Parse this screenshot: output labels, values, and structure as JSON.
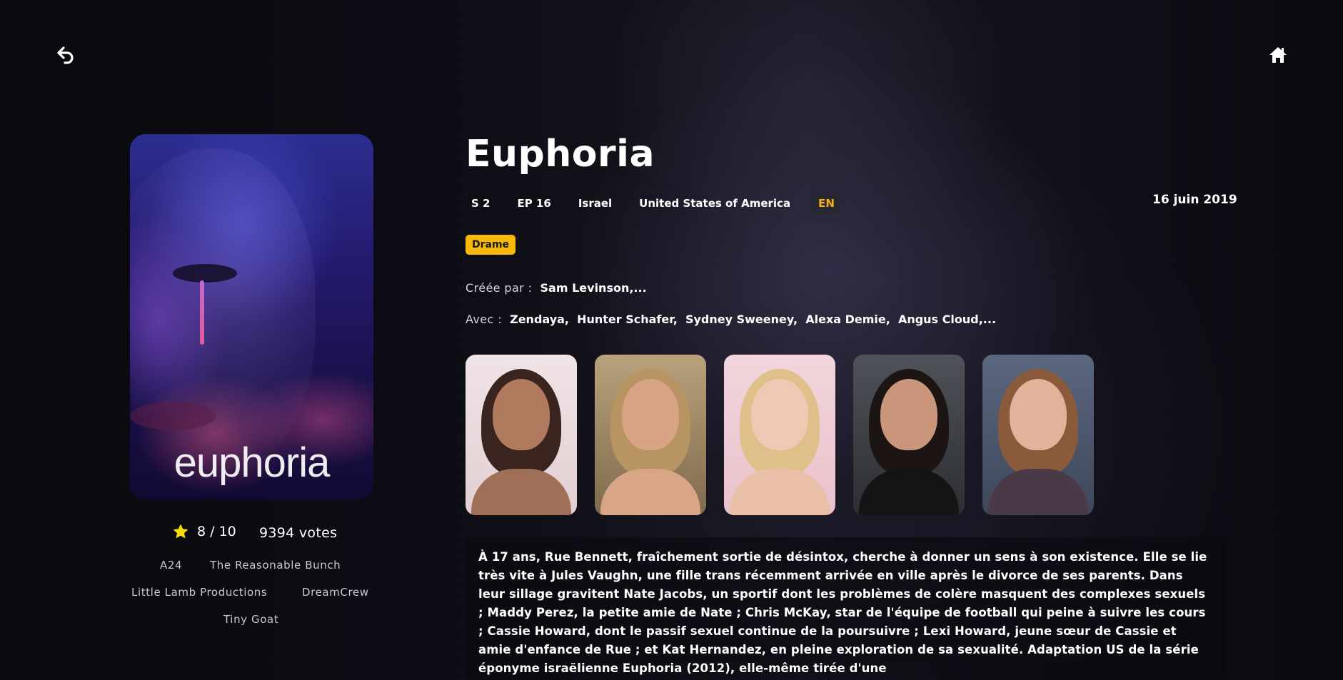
{
  "nav": {
    "back_icon": "undo-arrow-icon",
    "home_icon": "home-icon"
  },
  "show": {
    "title": "Euphoria",
    "poster_title": "euphoria",
    "season": "S 2",
    "episodes": "EP 16",
    "countries": [
      "Israel",
      "United States of America"
    ],
    "language": "EN",
    "date": "16 juin 2019",
    "genres": [
      "Drame"
    ],
    "created_by_label": "Créée par :",
    "created_by": "Sam Levinson,...",
    "cast_label": "Avec :",
    "cast": [
      "Zendaya,",
      "Hunter Schafer,",
      "Sydney Sweeney,",
      "Alexa Demie,",
      "Angus Cloud,..."
    ],
    "rating": "8 / 10",
    "votes": "9394 votes",
    "companies": [
      "A24",
      "The Reasonable Bunch",
      "Little Lamb Productions",
      "DreamCrew",
      "Tiny Goat"
    ],
    "synopsis": "À 17 ans, Rue Bennett, fraîchement sortie de désintox, cherche à donner un sens à son existence. Elle se lie très vite à Jules Vaughn, une fille trans récemment arrivée en ville après le divorce de ses parents. Dans leur sillage gravitent Nate Jacobs, un sportif dont les problèmes de colère masquent des complexes sexuels ; Maddy Perez, la petite amie de Nate ; Chris McKay, star de l'équipe de football qui peine à suivre les cours ; Cassie Howard, dont le passif sexuel continue de la poursuivre ; Lexi Howard, jeune sœur de Cassie et amie d'enfance de Rue ; et Kat Hernandez, en pleine exploration de sa sexualité. Adaptation US de la série éponyme israëlienne Euphoria (2012), elle-même tirée d'une"
  },
  "colors": {
    "accent_yellow": "#f5b90b",
    "language_badge_text": "#f5b21e",
    "star": "#f5d90b"
  }
}
